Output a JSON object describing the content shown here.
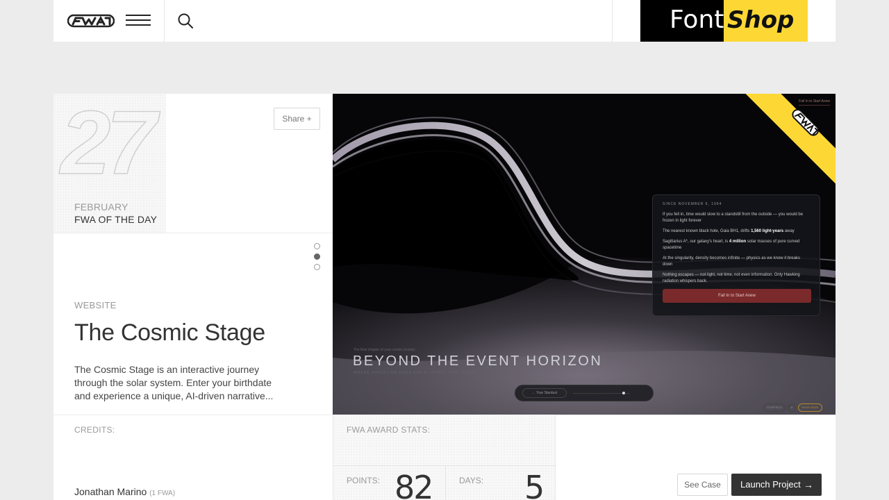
{
  "header": {
    "logo_icon": "fwa-logo",
    "menu_icon": "hamburger-menu-icon",
    "search_icon": "search-icon",
    "ad": {
      "part1": "Font",
      "part2": "Shop"
    }
  },
  "feature": {
    "day": "27",
    "month": "FEBRUARY",
    "badge": "FWA OF THE DAY",
    "share_label": "Share +",
    "type": "WEBSITE",
    "title": "The Cosmic Stage",
    "description": "The Cosmic Stage is an interactive journey through the solar system. Enter your birthdate and experience a unique, AI-driven narrative...",
    "slides": {
      "count": 3,
      "active_index": 1
    }
  },
  "preview": {
    "top_link": "Fall In to Start Anew",
    "panel": {
      "since": "SINCE NOVEMBER 6, 1994",
      "p1": "If you fell in, time would slow to a standstill from the outside — you would be frozen in light forever",
      "p2_pre": "The nearest known black hole, Gaia BH1, drifts ",
      "p2_bold": "1,560 light-years",
      "p2_post": " away",
      "p3_pre": "Sagittarius A*, our galaxy's heart, is ",
      "p3_bold": "4 million",
      "p3_post": " solar masses of pure curved spacetime",
      "p4": "At the singularity, density becomes infinite — physics as we know it breaks down",
      "p5": "Nothing escapes — not light, not time, not even information. Only Hawking radiation whispers back.",
      "button": "Fall In to Start Anew"
    },
    "heading_small": "The final chapter of your cosmic journey",
    "heading": "BEYOND THE EVENT HORIZON",
    "heading_sub": "WHERE SPACETIME ENDS AND A COSMIC TALE BEGINS",
    "nav_pill": "← Your Stardust",
    "corner_buttons": [
      "STARFIELD",
      "●",
      "SHOP MODE"
    ]
  },
  "credits": {
    "label": "CREDITS:",
    "name": "Jonathan Marino",
    "count": "(1 FWA)"
  },
  "stats": {
    "label": "FWA AWARD STATS:",
    "points_label": "POINTS:",
    "points": "82",
    "days_label": "DAYS:",
    "days": "5"
  },
  "actions": {
    "see_case": "See Case",
    "launch": "Launch Project",
    "launch_icon": "arrow-right-icon"
  }
}
